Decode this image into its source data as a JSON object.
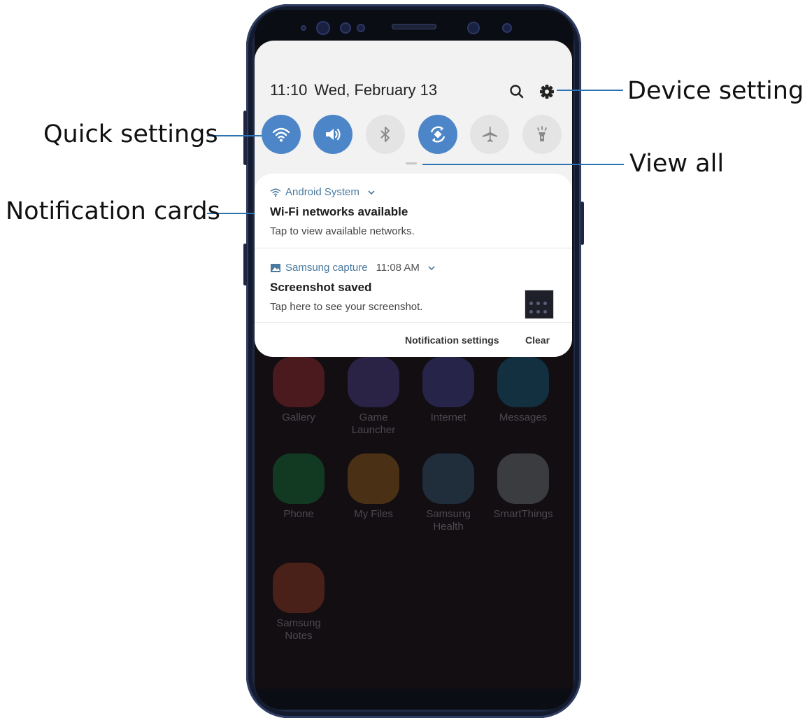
{
  "status": {
    "time": "11:10",
    "date": "Wed, February 13"
  },
  "quick_settings": [
    {
      "icon": "wifi-icon",
      "state": "on"
    },
    {
      "icon": "sound-icon",
      "state": "on"
    },
    {
      "icon": "bluetooth-icon",
      "state": "off"
    },
    {
      "icon": "auto-rotate-icon",
      "state": "on"
    },
    {
      "icon": "airplane-mode-icon",
      "state": "off"
    },
    {
      "icon": "flashlight-icon",
      "state": "off"
    }
  ],
  "notifications": [
    {
      "app": "Android System",
      "time": "",
      "title": "Wi-Fi networks available",
      "body": "Tap to view available networks."
    },
    {
      "app": "Samsung capture",
      "time": "11:08 AM",
      "title": "Screenshot saved",
      "body": "Tap here to see your screenshot."
    }
  ],
  "actions": {
    "notification_settings": "Notification settings",
    "clear": "Clear"
  },
  "home_apps": [
    {
      "label": "Gallery",
      "color": "#4a1a1e"
    },
    {
      "label": "Game Launcher",
      "color": "#2a2345"
    },
    {
      "label": "Internet",
      "color": "#27244a"
    },
    {
      "label": "Messages",
      "color": "#133040"
    },
    {
      "label": "Phone",
      "color": "#123a22"
    },
    {
      "label": "My Files",
      "color": "#4a3116"
    },
    {
      "label": "Samsung Health",
      "color": "#1f2e3a"
    },
    {
      "label": "SmartThings",
      "color": "#3b3c40"
    },
    {
      "label": "Samsung Notes",
      "color": "#4a2118"
    }
  ],
  "callouts": {
    "device_settings": "Device settings",
    "quick_settings": "Quick settings",
    "view_all": "View all",
    "notification_cards": "Notification cards"
  },
  "colors": {
    "accent": "#4d86c8",
    "leader": "#2b73b4",
    "app_name": "#4a7a9e"
  }
}
